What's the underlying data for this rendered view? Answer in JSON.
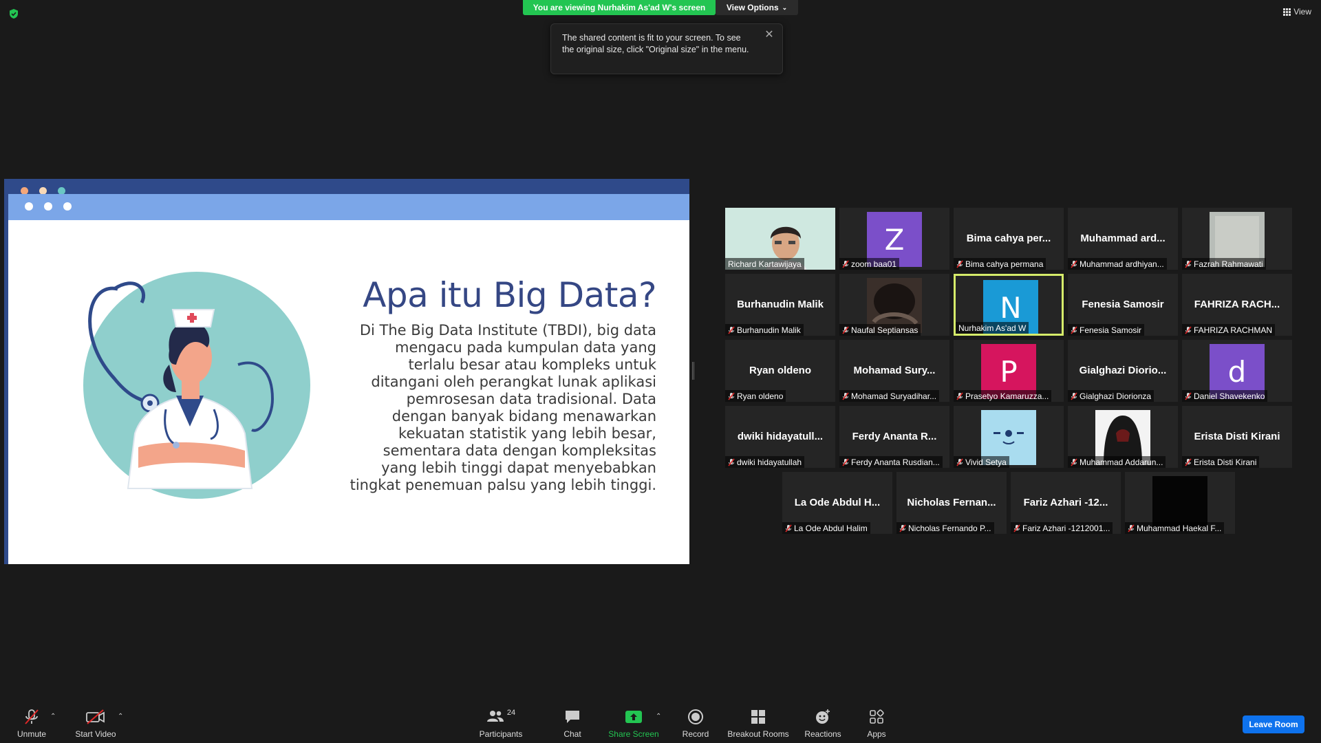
{
  "banner": {
    "viewing": "You are viewing Nurhakim As'ad W's screen",
    "view_options": "View Options"
  },
  "tooltip": {
    "text": "The shared content is fit to your screen. To see the original size, click \"Original size\" in the menu."
  },
  "top_right": {
    "view_label": "View"
  },
  "slide": {
    "title": "Apa itu Big Data?",
    "body": "Di The Big Data Institute (TBDI), big data mengacu pada kumpulan data yang terlalu besar atau kompleks untuk ditangani oleh perangkat lunak aplikasi pemrosesan data tradisional. Data dengan banyak bidang menawarkan kekuatan statistik yang lebih besar, sementara data dengan kompleksitas yang lebih tinggi dapat menyebabkan tingkat penemuan palsu yang lebih tinggi."
  },
  "participants": [
    {
      "big": "",
      "footer": "Richard Kartawijaya",
      "muted": false,
      "kind": "photo"
    },
    {
      "big": "",
      "footer": "zoom baa01",
      "muted": true,
      "kind": "avatar",
      "letter": "Z",
      "color": "#7b4fc9"
    },
    {
      "big": "Bima cahya per...",
      "footer": "Bima cahya permana",
      "muted": true,
      "kind": "name"
    },
    {
      "big": "Muhammad ard...",
      "footer": "Muhammad ardhiyan...",
      "muted": true,
      "kind": "name"
    },
    {
      "big": "",
      "footer": "Fazrah Rahmawati",
      "muted": true,
      "kind": "blur"
    },
    {
      "big": "Burhanudin Malik",
      "footer": "Burhanudin Malik",
      "muted": true,
      "kind": "name"
    },
    {
      "big": "",
      "footer": "Naufal Septiansas",
      "muted": true,
      "kind": "dark-photo"
    },
    {
      "big": "",
      "footer": "Nurhakim As'ad W",
      "muted": false,
      "kind": "avatar",
      "letter": "N",
      "color": "#1a9ad6",
      "active": true
    },
    {
      "big": "Fenesia Samosir",
      "footer": "Fenesia Samosir",
      "muted": true,
      "kind": "name"
    },
    {
      "big": "FAHRIZA RACH...",
      "footer": "FAHRIZA RACHMAN",
      "muted": true,
      "kind": "name"
    },
    {
      "big": "Ryan oldeno",
      "footer": "Ryan oldeno",
      "muted": true,
      "kind": "name"
    },
    {
      "big": "Mohamad Sury...",
      "footer": "Mohamad Suryadihar...",
      "muted": true,
      "kind": "name"
    },
    {
      "big": "",
      "footer": "Prasetyo Kamaruzza...",
      "muted": true,
      "kind": "avatar",
      "letter": "P",
      "color": "#d6155e"
    },
    {
      "big": "Gialghazi Diorio...",
      "footer": "Gialghazi Diorionza",
      "muted": true,
      "kind": "name"
    },
    {
      "big": "",
      "footer": "Daniel Shavekenko",
      "muted": true,
      "kind": "avatar",
      "letter": "d",
      "color": "#7b4fc9"
    },
    {
      "big": "dwiki hidayatull...",
      "footer": "dwiki hidayatullah",
      "muted": true,
      "kind": "name"
    },
    {
      "big": "Ferdy Ananta R...",
      "footer": "Ferdy Ananta Rusdian...",
      "muted": true,
      "kind": "name"
    },
    {
      "big": "",
      "footer": "Vivid Setya",
      "muted": true,
      "kind": "face"
    },
    {
      "big": "",
      "footer": "Muhammad Addarun...",
      "muted": true,
      "kind": "hood"
    },
    {
      "big": "Erista Disti Kirani",
      "footer": "Erista Disti Kirani",
      "muted": true,
      "kind": "name"
    },
    {
      "big": "La Ode Abdul H...",
      "footer": "La Ode Abdul Halim",
      "muted": true,
      "kind": "name"
    },
    {
      "big": "Nicholas Fernan...",
      "footer": "Nicholas Fernando P...",
      "muted": true,
      "kind": "name"
    },
    {
      "big": "Fariz Azhari -12...",
      "footer": "Fariz Azhari -1212001...",
      "muted": true,
      "kind": "name"
    },
    {
      "big": "",
      "footer": "Muhammad Haekal F...",
      "muted": true,
      "kind": "black"
    }
  ],
  "toolbar": {
    "unmute": "Unmute",
    "start_video": "Start Video",
    "participants": "Participants",
    "participants_count": "24",
    "chat": "Chat",
    "share_screen": "Share Screen",
    "record": "Record",
    "breakout_rooms": "Breakout Rooms",
    "reactions": "Reactions",
    "apps": "Apps",
    "leave_room": "Leave Room"
  },
  "colors": {
    "share_green": "#23c552",
    "leave_blue": "#0e72ed",
    "active_speaker": "#d6ec6a",
    "slide_title": "#354784"
  }
}
